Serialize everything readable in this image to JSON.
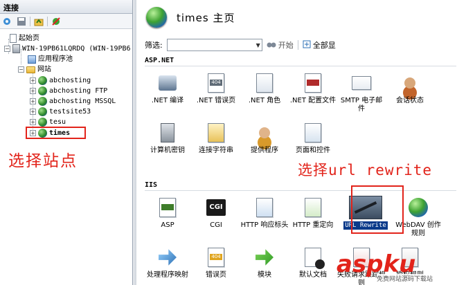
{
  "left_pane": {
    "header": "连接",
    "tree": [
      {
        "label": "起始页",
        "icon": "page-icon",
        "level": 1,
        "expander": ""
      },
      {
        "label": "WIN-19PB61LQRDQ (WIN-19PB6",
        "icon": "server-icon",
        "level": 1,
        "expander": "−"
      },
      {
        "label": "应用程序池",
        "icon": "app-pool-icon",
        "level": 2,
        "expander": ""
      },
      {
        "label": "网站",
        "icon": "folder-icon",
        "level": 2,
        "expander": "−"
      },
      {
        "label": "abchosting",
        "icon": "globe-icon",
        "level": 3,
        "expander": "+"
      },
      {
        "label": "abchosting FTP",
        "icon": "globe-icon",
        "level": 3,
        "expander": "+"
      },
      {
        "label": "abchosting MSSQL",
        "icon": "globe-icon",
        "level": 3,
        "expander": "+"
      },
      {
        "label": "testsite53",
        "icon": "globe-icon",
        "level": 3,
        "expander": "+"
      },
      {
        "label": "tesu",
        "icon": "globe-icon",
        "level": 3,
        "expander": "+"
      },
      {
        "label": "times",
        "icon": "globe-icon",
        "level": 3,
        "expander": "+"
      }
    ],
    "annotation": "选择站点"
  },
  "right_pane": {
    "title": "times 主页",
    "filter_label": "筛选:",
    "filter_value": "",
    "start_label": "开始",
    "show_all_label": "全部显",
    "groups": [
      {
        "header": "ASP.NET"
      },
      {
        "header": "IIS"
      }
    ],
    "aspnet_items": [
      {
        "label": ".NET 编译",
        "icon": "compile-icon"
      },
      {
        "label": ".NET 错误页",
        "icon": "error-page-icon"
      },
      {
        "label": ".NET 角色",
        "icon": "roles-icon"
      },
      {
        "label": ".NET 配置文件",
        "icon": "profile-icon"
      },
      {
        "label": "SMTP 电子邮件",
        "icon": "smtp-icon"
      },
      {
        "label": "会话状态",
        "icon": "session-icon"
      },
      {
        "label": "计算机密钥",
        "icon": "machine-key-icon"
      },
      {
        "label": "连接字符串",
        "icon": "connection-string-icon"
      },
      {
        "label": "提供程序",
        "icon": "providers-icon"
      },
      {
        "label": "页面和控件",
        "icon": "pages-controls-icon"
      }
    ],
    "iis_items": [
      {
        "label": "ASP",
        "icon": "asp-icon"
      },
      {
        "label": "CGI",
        "icon": "cgi-icon"
      },
      {
        "label": "HTTP 响应标头",
        "icon": "http-headers-icon"
      },
      {
        "label": "HTTP 重定向",
        "icon": "http-redirect-icon"
      },
      {
        "label": "URL Rewrite",
        "icon": "url-rewrite-icon"
      },
      {
        "label": "WebDAV 创作规则",
        "icon": "webdav-icon"
      },
      {
        "label": "处理程序映射",
        "icon": "handler-mappings-icon"
      },
      {
        "label": "错误页",
        "icon": "error-pages-icon"
      },
      {
        "label": "模块",
        "icon": "modules-icon"
      },
      {
        "label": "默认文档",
        "icon": "default-document-icon"
      },
      {
        "label": "失败请求跟踪规则",
        "icon": "failed-request-icon"
      },
      {
        "label": "授权规则",
        "icon": "authorization-icon"
      }
    ],
    "annotation": "选择url rewrite"
  },
  "watermark": {
    "text": "aspku",
    "subtitle": "免费网站源码下载站"
  },
  "colors": {
    "annotation_red": "#e2231a",
    "selection_blue": "#0a3a8a"
  }
}
